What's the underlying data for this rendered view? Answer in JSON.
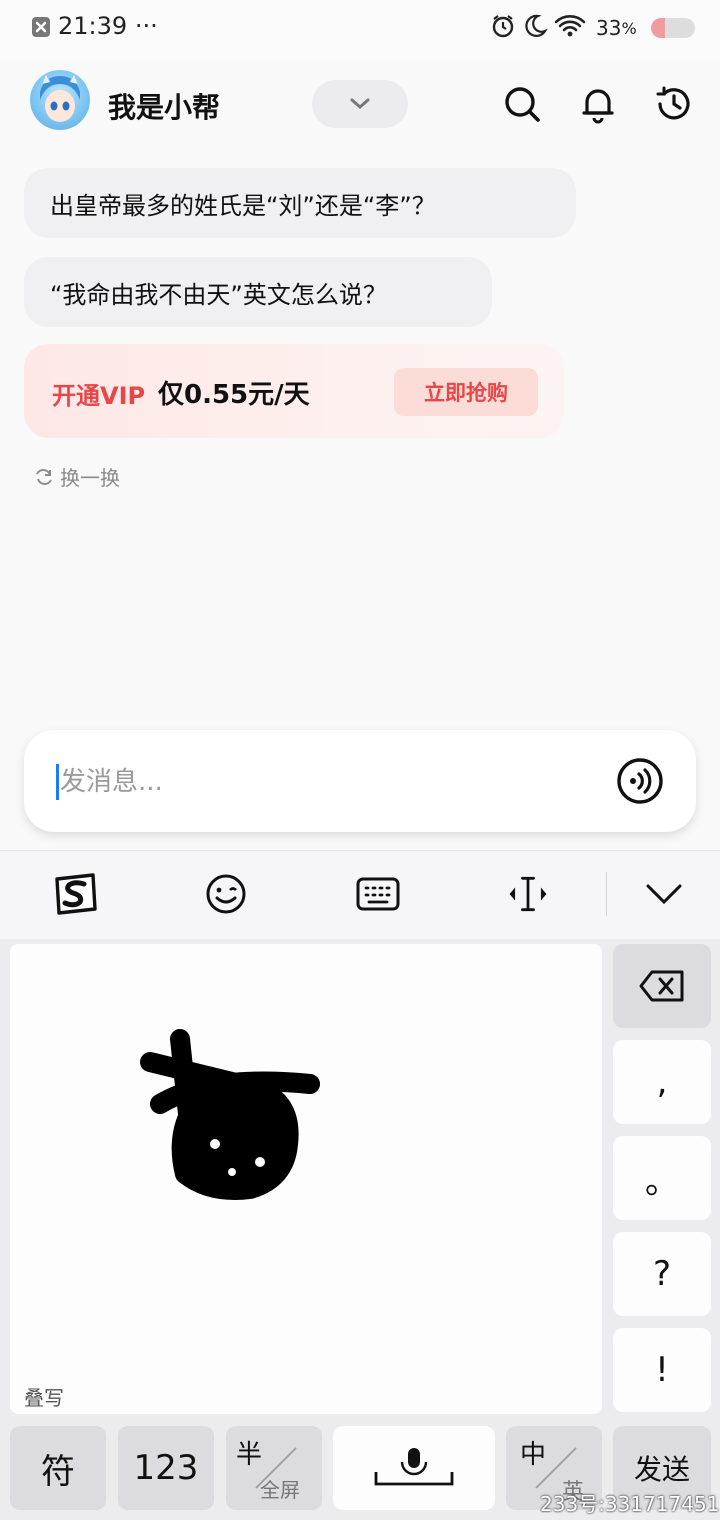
{
  "status_bar": {
    "time": "21:39",
    "dots": "···",
    "battery": "33"
  },
  "header": {
    "title": "我是小帮"
  },
  "suggestions": [
    "出皇帝最多的姓氏是“刘”还是“李”？",
    "“我命由我不由天”英文怎么说？"
  ],
  "vip": {
    "promo_red": "开通VIP",
    "promo_price": "仅0.55元/天",
    "button": "立即抢购"
  },
  "refresh_label": "换一换",
  "input": {
    "placeholder": "发消息..."
  },
  "keyboard": {
    "mode_label": "叠写",
    "side_keys": [
      ",",
      "。",
      "?",
      "!"
    ],
    "bottom_keys": {
      "symbols": "符",
      "numbers": "123",
      "half": "半",
      "full": "全屏",
      "chinese": "中",
      "english": "英",
      "send": "发送"
    }
  },
  "watermark": "233号:331717451"
}
